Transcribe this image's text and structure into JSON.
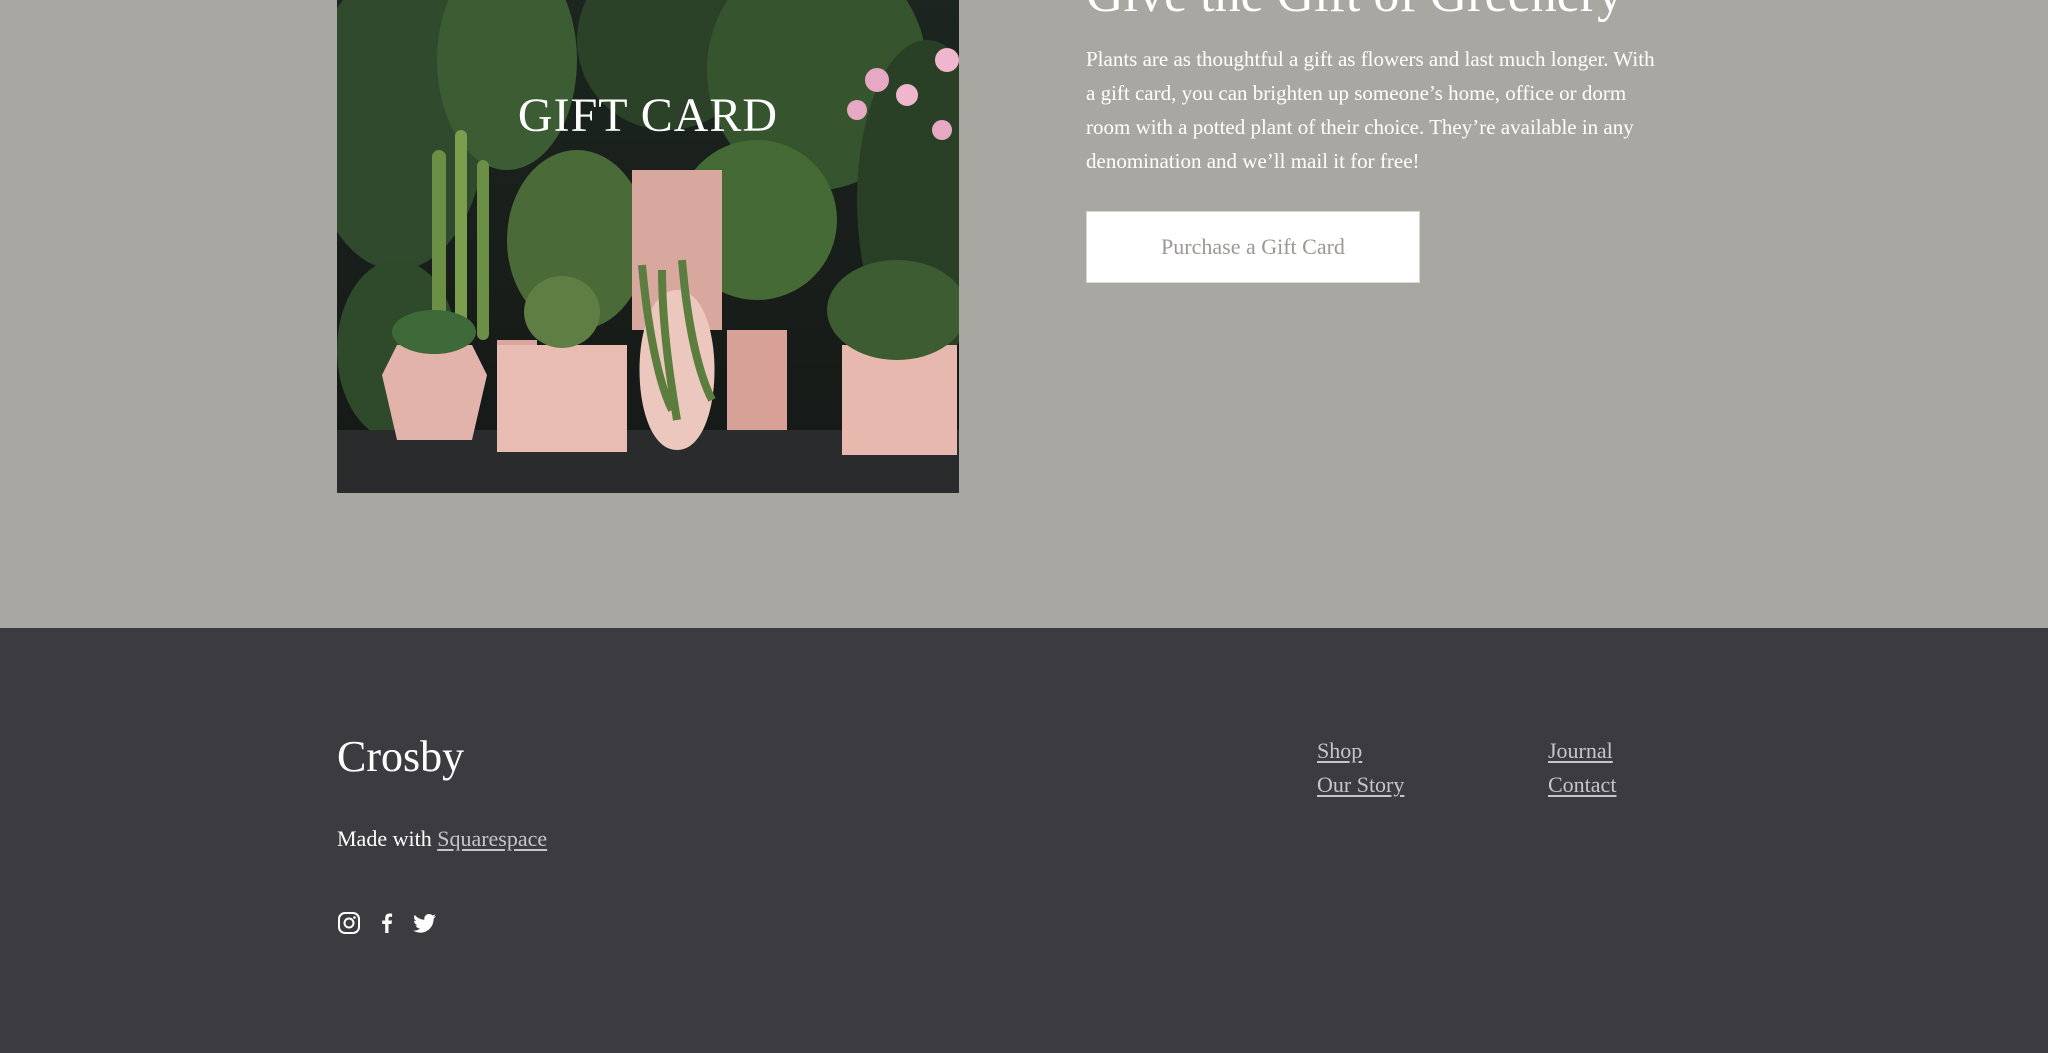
{
  "gift": {
    "image_label": "GIFT CARD",
    "heading": "Give the Gift of Greenery",
    "body": "Plants are as thoughtful a gift as flowers and last much longer. With a gift card, you can brighten up someone’s home, office or dorm room with a potted plant of their choice. They’re available in any denomination and we’ll mail it for free!",
    "button_label": "Purchase a Gift Card"
  },
  "footer": {
    "logo": "Crosby",
    "made_with_prefix": "Made with",
    "made_with_link": "Squarespace",
    "social_icons": [
      "instagram-icon",
      "facebook-icon",
      "twitter-icon"
    ],
    "nav_col_1": [
      "Shop",
      "Our Story"
    ],
    "nav_col_2": [
      "Journal",
      "Contact"
    ]
  },
  "colors": {
    "section_bg": "#a9a7a2",
    "footer_bg": "#3b3b40",
    "button_text": "#9a9893"
  }
}
